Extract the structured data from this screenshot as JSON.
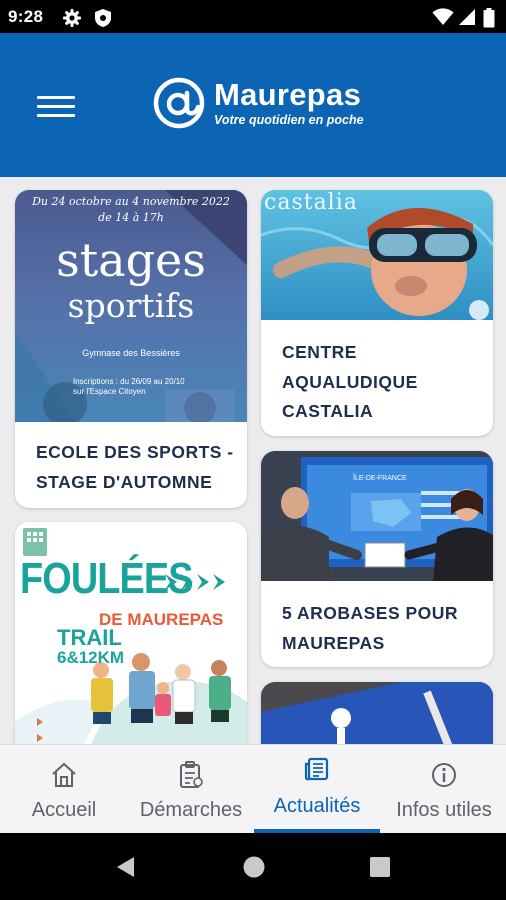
{
  "status_bar": {
    "time": "9:28",
    "icons": [
      "settings-icon",
      "shield-icon",
      "wifi-icon",
      "signal-icon",
      "battery-icon"
    ]
  },
  "header": {
    "logo_symbol": "@",
    "title": "Maurepas",
    "tagline": "Votre quotidien en poche",
    "menu_icon": "hamburger-menu-icon",
    "brand_color": "#0b64b4"
  },
  "cards": [
    {
      "title": "Ecole des sports - stage d'automne",
      "image": {
        "line1": "Du 24 octobre au 4 novembre 2022",
        "line2": "de 14 à 17h",
        "word1": "stages",
        "word2": "sportifs",
        "place": "Gymnase des Bessières",
        "info1": "Inscriptions : du 26/09 au 20/10",
        "info2": "sur l'Espace Citoyen"
      }
    },
    {
      "title": "Centre aqualudique Castalia",
      "image": {
        "brand": "castalia"
      }
    },
    {
      "title": "5 arobases pour Maurepas",
      "image": {
        "screen_text": "ÎLE-DE-FRANCE"
      }
    },
    {
      "title": "",
      "image": {
        "word1": "FOULÉES",
        "word2": "DE MAUREPAS",
        "word3": "TRAIL",
        "word4": "6&12KM"
      }
    },
    {
      "title": "",
      "image": {
        "subject": "parking"
      }
    }
  ],
  "bottom_nav": {
    "items": [
      {
        "label": "Accueil",
        "icon": "home-icon",
        "active": false
      },
      {
        "label": "Démarches",
        "icon": "clipboard-icon",
        "active": false
      },
      {
        "label": "Actualités",
        "icon": "newspaper-icon",
        "active": true
      },
      {
        "label": "Infos utiles",
        "icon": "info-icon",
        "active": false
      }
    ],
    "active_color": "#0b64b4"
  },
  "system_nav": {
    "buttons": [
      "back-icon",
      "home-circle-icon",
      "recents-icon"
    ]
  }
}
